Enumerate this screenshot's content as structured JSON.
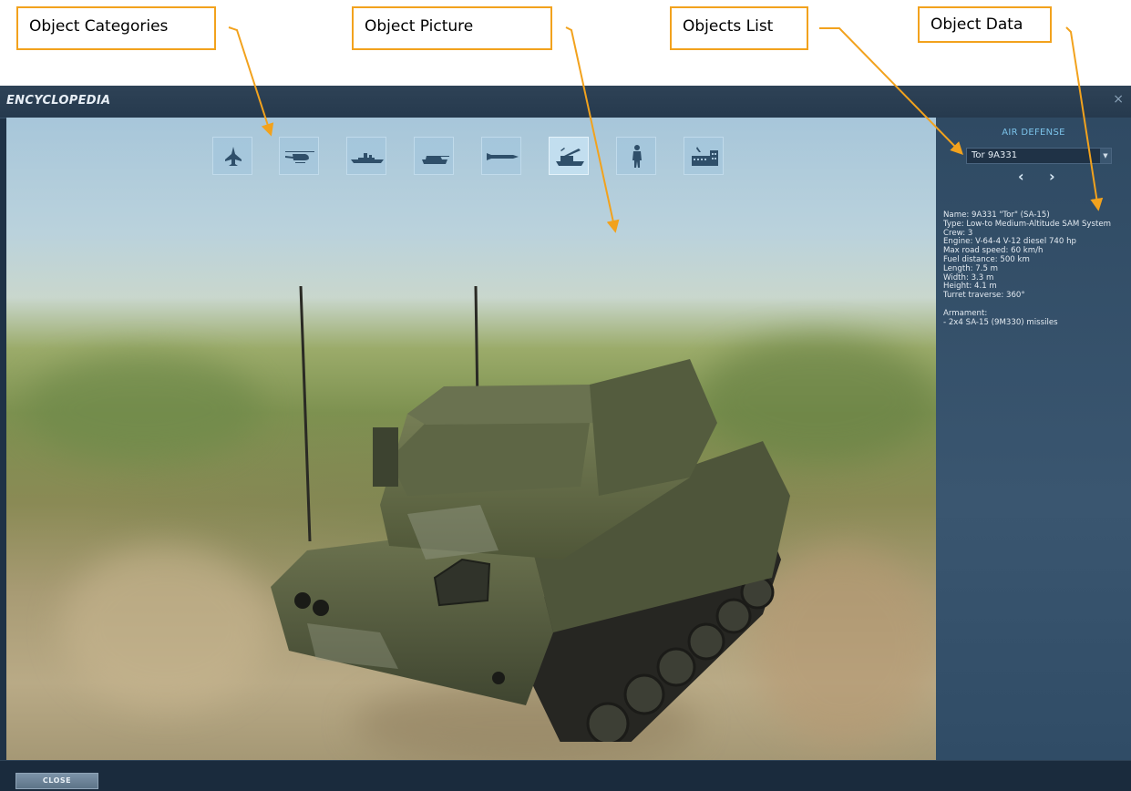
{
  "annotations": {
    "categories": "Object Categories",
    "picture": "Object Picture",
    "list": "Objects List",
    "data": "Object Data"
  },
  "window": {
    "title": "ENCYCLOPEDIA",
    "close_glyph": "×"
  },
  "categories": [
    {
      "name": "aircraft",
      "icon": "jet-icon",
      "active": false
    },
    {
      "name": "helicopters",
      "icon": "helicopter-icon",
      "active": false
    },
    {
      "name": "ships",
      "icon": "ship-icon",
      "active": false
    },
    {
      "name": "tanks",
      "icon": "tank-icon",
      "active": false
    },
    {
      "name": "weapons",
      "icon": "missile-icon",
      "active": false
    },
    {
      "name": "air-defense",
      "icon": "sam-launcher-icon",
      "active": true
    },
    {
      "name": "personnel",
      "icon": "soldier-icon",
      "active": false
    },
    {
      "name": "structures",
      "icon": "buildings-icon",
      "active": false
    }
  ],
  "panel": {
    "category_name": "AIR DEFENSE",
    "selected_object": "Tor 9A331",
    "prev_glyph": "‹",
    "next_glyph": "›",
    "details": [
      "Name: 9A331 \"Tor\" (SA-15)",
      "Type: Low-to Medium-Altitude SAM System",
      "Crew: 3",
      "Engine: V-64-4 V-12 diesel 740 hp",
      "Max road speed: 60 km/h",
      "Fuel distance: 500 km",
      "Length: 7.5 m",
      "Width: 3.3 m",
      "Height: 4.1 m",
      "Turret traverse: 360°"
    ],
    "armament_heading": "Armament:",
    "armament": [
      "- 2x4 SA-15 (9M330) missiles"
    ]
  },
  "footer": {
    "close_label": "CLOSE"
  },
  "colors": {
    "callout_border": "#f2a21d",
    "accent": "#7bc2e9",
    "window_bg": "#1f3246"
  }
}
